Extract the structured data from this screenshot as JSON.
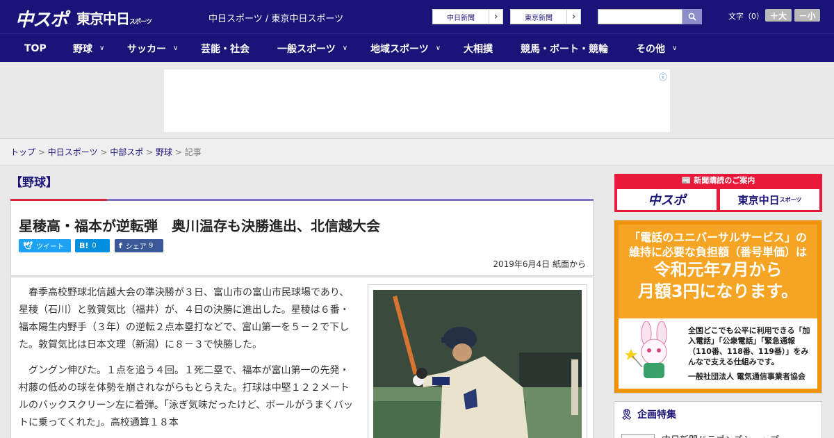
{
  "header": {
    "logo_chuspo": "中スポ",
    "logo_tokyo": "東京中日",
    "logo_tokyo_small": "スポーツ",
    "site_title": "中日スポーツ / 東京中日スポーツ",
    "ext_links": [
      "中日新聞",
      "東京新聞"
    ],
    "search_placeholder": "",
    "font_size_label": "文字（0）",
    "font_plus": "＋大",
    "font_minus": "－小"
  },
  "nav": {
    "items": [
      {
        "label": "TOP",
        "has_menu": false
      },
      {
        "label": "野球",
        "has_menu": true
      },
      {
        "label": "サッカー",
        "has_menu": true
      },
      {
        "label": "芸能・社会",
        "has_menu": false
      },
      {
        "label": "一般スポーツ",
        "has_menu": true
      },
      {
        "label": "地域スポーツ",
        "has_menu": true
      },
      {
        "label": "大相撲",
        "has_menu": false
      },
      {
        "label": "競馬・ボート・競輪",
        "has_menu": false
      },
      {
        "label": "その他",
        "has_menu": true
      }
    ]
  },
  "ad": {
    "info_icon": "ⓘ"
  },
  "breadcrumb": {
    "items": [
      "トップ",
      "中日スポーツ",
      "中部スポ",
      "野球"
    ],
    "current": "記事",
    "separator": ">"
  },
  "section": {
    "label": "【野球】"
  },
  "article": {
    "headline": "星稜高・福本が逆転弾　奥川温存も決勝進出、北信越大会",
    "share": {
      "twitter_label": "ツイート",
      "hatena_label": "B!",
      "hatena_count": "0",
      "facebook_label": "シェア",
      "facebook_count": "9"
    },
    "dateline": "2019年6月4日 紙面から",
    "paragraphs": [
      "春季高校野球北信越大会の準決勝が３日、富山市の富山市民球場であり、星稜（石川）と敦賀気比（福井）が、４日の決勝に進出した。星稜は６番・福本陽生内野手（３年）の逆転２点本塁打などで、富山第一を５－２で下した。敦賀気比は日本文理（新潟）に８－３で快勝した。",
      "グングン伸びた。１点を追う４回。１死二塁で、福本が富山第一の先発・村藤の低めの球を体勢を崩されながらもとらえた。打球は中堅１２２メートルのバックスクリーン左に着弾。「泳ぎ気味だったけど、ボールがうまくバットに乗ってくれた」。高校通算１８本"
    ]
  },
  "sidebar": {
    "subscribe_header": "新聞購読のご案内",
    "subscribe_buttons": [
      "中スポ",
      "東京中日"
    ],
    "subscribe_small": "スポーツ",
    "promo_line1": "「電話のユニバーサルサービス」の",
    "promo_line2": "維持に必要な負担額（番号単価）は",
    "promo_line3": "令和元年7月から",
    "promo_line4": "月額3円になります。",
    "promo_desc": "全国どこでも公平に利用できる「加入電話」「公衆電話」「緊急通報（110番、118番、119番）」をみんなで支える仕組みです。",
    "promo_org": "一般社団法人 電気通信事業者協会",
    "feature_title": "企画特集",
    "feature_item": "中日新聞ドラゴンズショップ"
  },
  "colors": {
    "brand_navy": "#1a1478",
    "accent_red": "#d62a3c",
    "accent_purple": "#7d74c8",
    "twitter": "#1da1f2",
    "hatena": "#008fde",
    "facebook": "#3b5998",
    "promo_orange": "#f6a423"
  }
}
